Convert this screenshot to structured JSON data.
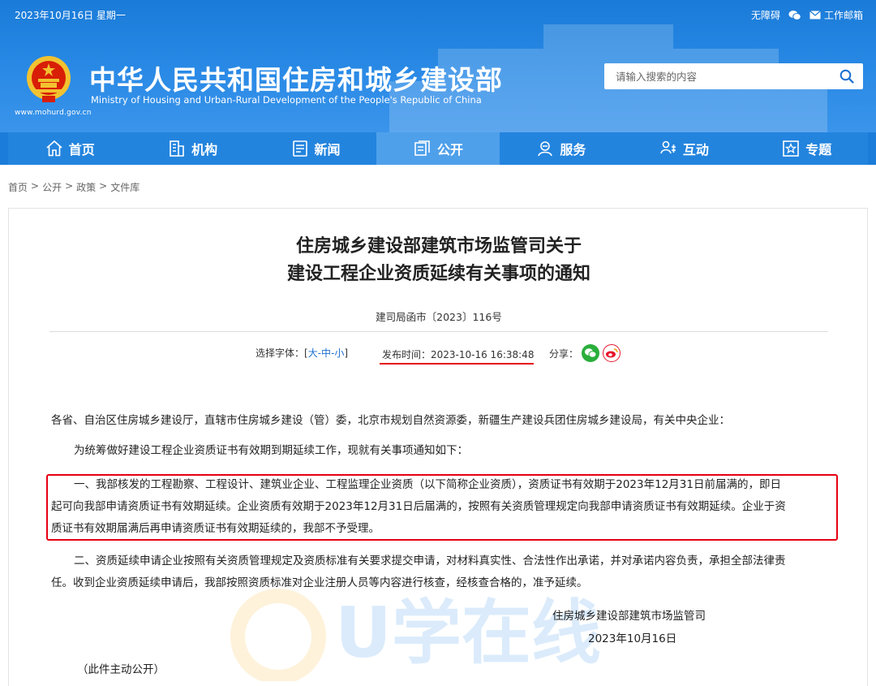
{
  "topbar": {
    "date": "2023年10月16日 星期一",
    "accessibility_label": "无障碍",
    "mail_label": "工作邮箱"
  },
  "brand": {
    "title_cn": "中华人民共和国住房和城乡建设部",
    "title_en": "Ministry of Housing and Urban-Rural Development of the People's Republic of China",
    "url": "www.mohurd.gov.cn"
  },
  "search": {
    "placeholder": "请输入搜索的内容"
  },
  "nav": {
    "items": [
      {
        "label": "首页",
        "icon": "home-icon"
      },
      {
        "label": "机构",
        "icon": "building-icon"
      },
      {
        "label": "新闻",
        "icon": "news-icon"
      },
      {
        "label": "公开",
        "icon": "document-icon",
        "active": true
      },
      {
        "label": "服务",
        "icon": "service-icon"
      },
      {
        "label": "互动",
        "icon": "chat-icon"
      },
      {
        "label": "专题",
        "icon": "star-icon"
      }
    ]
  },
  "breadcrumb": [
    "首页",
    ">",
    "公开",
    ">",
    "政策",
    ">",
    "文件库"
  ],
  "article": {
    "title_line1": "住房城乡建设部建筑市场监管司关于",
    "title_line2": "建设工程企业资质延续有关事项的通知",
    "doc_number": "建司局函市〔2023〕116号",
    "font_select_label": "选择字体：[",
    "font_large": "大",
    "font_sep1": " - ",
    "font_medium": "中",
    "font_sep2": " - ",
    "font_small": "小",
    "font_close": "]",
    "publish_time": "发布时间：2023-10-16 16:38:48",
    "share_label": "分享：",
    "salutation": "各省、自治区住房城乡建设厅，直辖市住房城乡建设（管）委，北京市规划自然资源委，新疆生产建设兵团住房城乡建设局，有关中央企业：",
    "intro": "为统筹做好建设工程企业资质证书有效期到期延续工作，现就有关事项通知如下：",
    "point1_line1": "一、我部核发的工程勘察、工程设计、建筑业企业、工程监理企业资质（以下简称企业资质），资质证书有效期于2023年12月31日前届满的，即日",
    "point1_line2": "起可向我部申请资质证书有效期延续。企业资质有效期于2023年12月31日后届满的，按照有关资质管理规定向我部申请资质证书有效期延续。企业于资",
    "point1_line3": "质证书有效期届满后再申请资质证书有效期延续的，我部不予受理。",
    "point2_line1": "二、资质延续申请企业按照有关资质管理规定及资质标准有关要求提交申请，对材料真实性、合法性作出承诺，并对承诺内容负责，承担全部法律责",
    "point2_line2": "任。收到企业资质延续申请后，我部按照资质标准对企业注册人员等内容进行核查，经核查合格的，准予延续。",
    "signature_org": "住房城乡建设部建筑市场监管司",
    "signature_date": "2023年10月16日",
    "disclosure": "（此件主动公开）"
  },
  "watermark_text": "U学在线",
  "colors": {
    "header_blue": "#1a7bd8",
    "nav_blue": "#2384de",
    "nav_active": "#4fa0ea",
    "highlight_red": "#e60012",
    "link_blue": "#1a6fd1",
    "wechat_green": "#2aae3b",
    "weibo_red": "#e6162d"
  }
}
